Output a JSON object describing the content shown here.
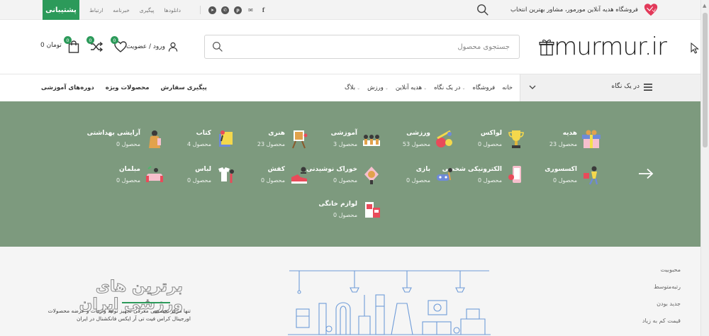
{
  "topbar": {
    "support_label": "پشتیبانی",
    "links": [
      "ارتباط",
      "خبرنامه",
      "پیگیری",
      "دانلودها"
    ],
    "tagline": "فروشگاه هدیه آنلاین مورمور، مشاور بهترین انتخاب",
    "socials": [
      "telegram-icon",
      "whatsapp-icon",
      "pinterest-icon",
      "email-icon",
      "facebook-icon"
    ]
  },
  "header": {
    "logo_text": "murmur.ir",
    "search_placeholder": "جستجوی محصول",
    "login_label": "ورود / عضویت",
    "wishlist_count": "0",
    "compare_count": "0",
    "cart_count": "0",
    "cart_total": "0 تومان"
  },
  "nav": {
    "categories_label": "در یک نگاه",
    "menu": [
      {
        "label": "خانه",
        "dropdown": false
      },
      {
        "label": "فروشگاه",
        "dropdown": false
      },
      {
        "label": "در یک نگاه",
        "dropdown": true
      },
      {
        "label": "هدیه آنلاین",
        "dropdown": true
      },
      {
        "label": "ورزش",
        "dropdown": true
      },
      {
        "label": "بلاگ",
        "dropdown": true
      }
    ],
    "extra_links": [
      "دوره‌های آموزشی",
      "محصولات ویژه",
      "پیگیری سفارش"
    ]
  },
  "categories": [
    {
      "name": "هدیه",
      "count": "23 محصول"
    },
    {
      "name": "لواکس",
      "count": "0 محصول"
    },
    {
      "name": "ورزشی",
      "count": "53 محصول"
    },
    {
      "name": "آموزشی",
      "count": "3 محصول"
    },
    {
      "name": "هنری",
      "count": "23 محصول"
    },
    {
      "name": "کتاب",
      "count": "4 محصول"
    },
    {
      "name": "آرایشی بهداشتی",
      "count": "0 محصول"
    },
    {
      "name": "اکسسوری",
      "count": "0 محصول"
    },
    {
      "name": "الکترونیکی شخصی",
      "count": "0 محصول"
    },
    {
      "name": "بازی",
      "count": "0 محصول"
    },
    {
      "name": "خوراک نوشیدنی",
      "count": "0 محصول"
    },
    {
      "name": "کفش",
      "count": "0 محصول"
    },
    {
      "name": "لباس",
      "count": "0 محصول"
    },
    {
      "name": "مبلمان",
      "count": "0 محصول"
    },
    {
      "name": "لوازم خانگی",
      "count": "0 محصول"
    }
  ],
  "hero": {
    "title": "برترین های ورزشی ایران",
    "description": "تنها مرکز تخصصی معرفی تجهیز تولید واردات و عرضه محصولات اورجینال کراس فیت تی آر ایکس فانکشنال در ایران"
  },
  "sort_options": [
    "محبوبیت",
    "رتبه‌متوسط",
    "جدید بودن",
    "قیمت کم به زیاد"
  ],
  "colors": {
    "accent": "#2c9a5a",
    "category_bg": "#7d9a7e",
    "illustration": "#6e9bd8"
  }
}
